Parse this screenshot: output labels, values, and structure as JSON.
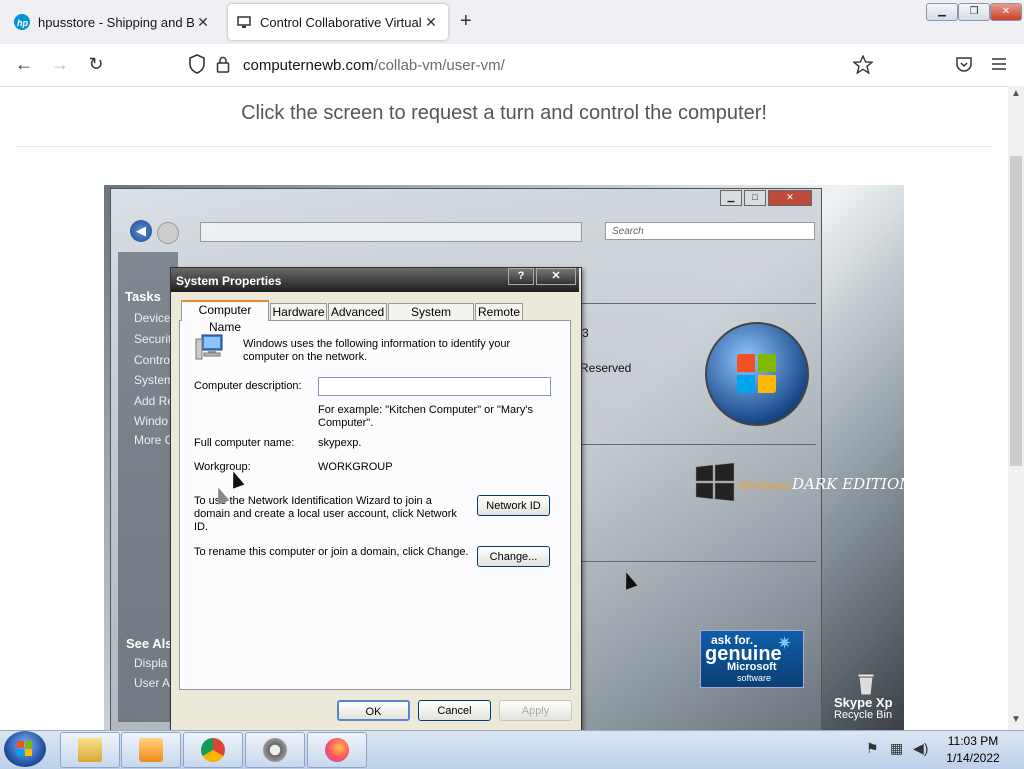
{
  "browser": {
    "tabs": [
      {
        "label": "hpusstore - Shipping and Billing",
        "favicon": "hp-logo-icon",
        "close": "✕"
      },
      {
        "label": "Control Collaborative Virtual M",
        "favicon": "computernewb-icon",
        "close": "✕"
      }
    ],
    "new_tab": "+",
    "window_controls": {
      "minimize": "▁",
      "maximize": "❐",
      "close": "✕"
    },
    "nav": {
      "back": "←",
      "forward": "→",
      "reload": "↻"
    },
    "url": {
      "domain": "computernewb.com",
      "path": "/collab-vm/user-vm/"
    },
    "toolbar_icons": [
      "shield-icon",
      "lock-icon",
      "star-icon",
      "pocket-icon",
      "menu-icon"
    ]
  },
  "page": {
    "headline": "Click the screen to request a turn and control the computer!"
  },
  "vm": {
    "explorer": {
      "search_placeholder": "Search",
      "tasks_title": "Tasks",
      "task_items": [
        "Device",
        "Securit",
        "Contro",
        "System",
        "Add Re",
        "Windo",
        "More C"
      ],
      "see_also": "See Als",
      "see_also_items": [
        "Displa",
        "User A"
      ],
      "partial_right_1": "3",
      "partial_right_2": "Reserved",
      "back": "◀"
    },
    "desktop": {
      "windows_text": "Windows",
      "dark_edition": "DARK EDITION",
      "ask_for": "ask for.",
      "genuine": "genuine",
      "microsoft": "Microsoft",
      "software": "software",
      "skype": "Skype Xp",
      "recycle": "Recycle Bin"
    },
    "dialog": {
      "title": "System Properties",
      "help": "?",
      "close": "✕",
      "tabs": [
        "Computer Name",
        "Hardware",
        "Advanced",
        "System Restore",
        "Remote"
      ],
      "intro": "Windows uses the following information to identify your computer on the network.",
      "desc_label": "Computer description:",
      "desc_value": "",
      "example": "For example: \"Kitchen Computer\" or \"Mary's Computer\".",
      "full_name_label": "Full computer name:",
      "full_name_value": "skypexp.",
      "workgroup_label": "Workgroup:",
      "workgroup_value": "WORKGROUP",
      "wizard_text": "To use the Network Identification Wizard to join a domain and create a local user account, click Network ID.",
      "network_id_btn": "Network ID",
      "rename_text": "To rename this computer or join a domain, click Change.",
      "change_btn": "Change...",
      "ok": "OK",
      "cancel": "Cancel",
      "apply": "Apply"
    }
  },
  "taskbar": {
    "apps": [
      "explorer-folder-icon",
      "media-player-icon",
      "chrome-icon",
      "settings-gear-icon",
      "firefox-icon"
    ],
    "time": "11:03 PM",
    "date": "1/14/2022"
  }
}
